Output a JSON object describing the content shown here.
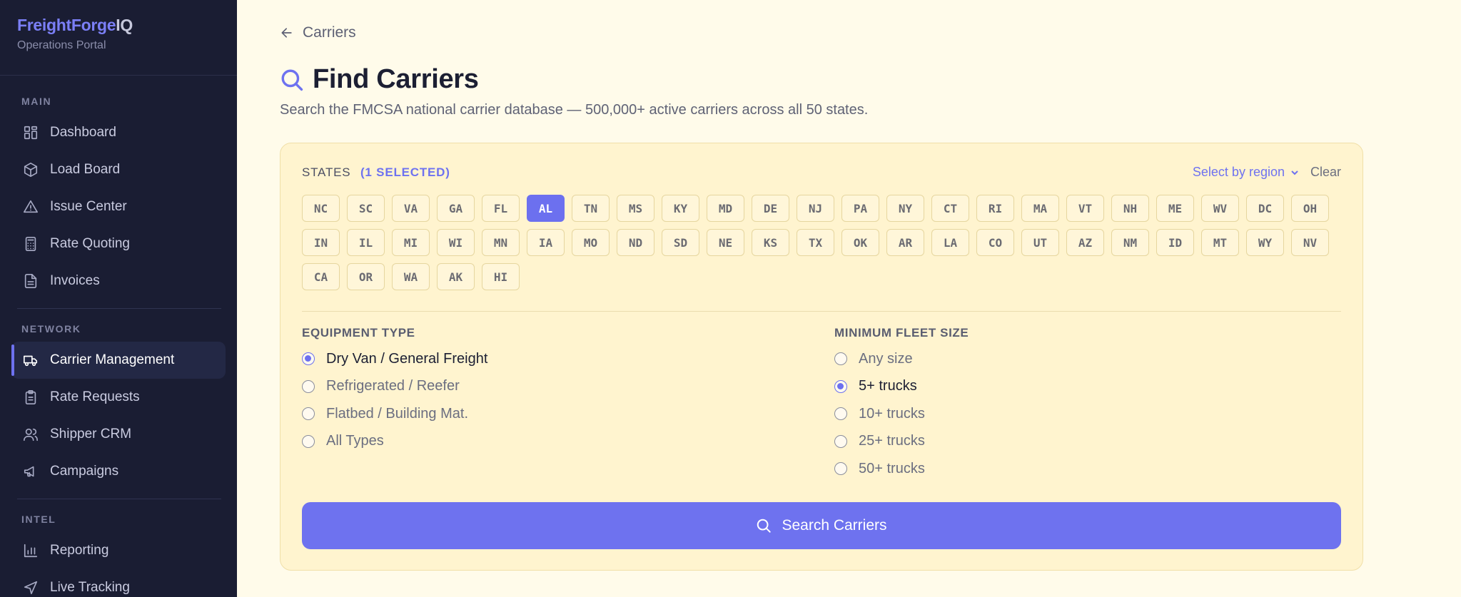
{
  "brand": {
    "name_part1": "FreightForge",
    "name_part2": "IQ",
    "subtitle": "Operations Portal"
  },
  "sidebar": {
    "sections": [
      {
        "label": "MAIN",
        "items": [
          {
            "label": "Dashboard",
            "icon": "grid-icon"
          },
          {
            "label": "Load Board",
            "icon": "box-icon"
          },
          {
            "label": "Issue Center",
            "icon": "alert-triangle-icon"
          },
          {
            "label": "Rate Quoting",
            "icon": "calculator-icon"
          },
          {
            "label": "Invoices",
            "icon": "file-text-icon"
          }
        ]
      },
      {
        "label": "NETWORK",
        "items": [
          {
            "label": "Carrier Management",
            "icon": "truck-icon",
            "active": true
          },
          {
            "label": "Rate Requests",
            "icon": "clipboard-icon"
          },
          {
            "label": "Shipper CRM",
            "icon": "users-icon"
          },
          {
            "label": "Campaigns",
            "icon": "megaphone-icon"
          }
        ]
      },
      {
        "label": "INTEL",
        "items": [
          {
            "label": "Reporting",
            "icon": "bar-chart-icon"
          },
          {
            "label": "Live Tracking",
            "icon": "navigation-icon"
          }
        ]
      }
    ]
  },
  "header": {
    "back_label": "Carriers",
    "title": "Find Carriers",
    "subtitle": "Search the FMCSA national carrier database — 500,000+ active carriers across all 50 states."
  },
  "filters": {
    "states_label": "STATES",
    "selected_count": "(1 SELECTED)",
    "region_label": "Select by region",
    "clear_label": "Clear",
    "states": [
      "NC",
      "SC",
      "VA",
      "GA",
      "FL",
      "AL",
      "TN",
      "MS",
      "KY",
      "MD",
      "DE",
      "NJ",
      "PA",
      "NY",
      "CT",
      "RI",
      "MA",
      "VT",
      "NH",
      "ME",
      "WV",
      "DC",
      "OH",
      "IN",
      "IL",
      "MI",
      "WI",
      "MN",
      "IA",
      "MO",
      "ND",
      "SD",
      "NE",
      "KS",
      "TX",
      "OK",
      "AR",
      "LA",
      "CO",
      "UT",
      "AZ",
      "NM",
      "ID",
      "MT",
      "WY",
      "NV",
      "CA",
      "OR",
      "WA",
      "AK",
      "HI"
    ],
    "selected_states": [
      "AL"
    ],
    "equipment": {
      "label": "EQUIPMENT TYPE",
      "options": [
        "Dry Van / General Freight",
        "Refrigerated / Reefer",
        "Flatbed / Building Mat.",
        "All Types"
      ],
      "selected": "Dry Van / General Freight"
    },
    "fleet": {
      "label": "MINIMUM FLEET SIZE",
      "options": [
        "Any size",
        "5+ trucks",
        "10+ trucks",
        "25+ trucks",
        "50+ trucks"
      ],
      "selected": "5+ trucks"
    },
    "search_label": "Search Carriers"
  },
  "colors": {
    "accent": "#6e72ef",
    "sidebar_bg": "#1a1d33",
    "page_bg": "#fffbea",
    "card_bg": "#fff4cf"
  }
}
